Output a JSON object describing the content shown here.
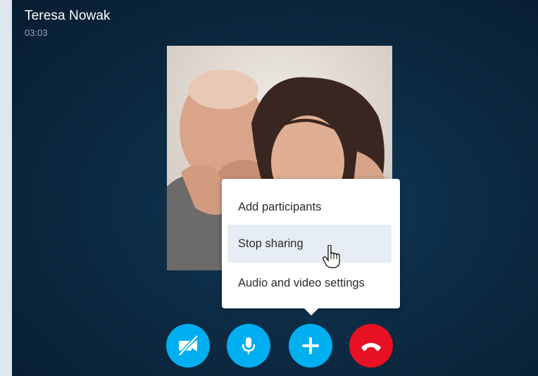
{
  "call": {
    "caller_name": "Teresa Nowak",
    "duration": "03:03"
  },
  "menu": {
    "items": [
      {
        "label": "Add participants"
      },
      {
        "label": "Stop sharing",
        "hovered": true
      },
      {
        "label": "Audio and video settings"
      }
    ]
  },
  "controls": [
    {
      "icon": "video-off-icon",
      "color": "#00aff0"
    },
    {
      "icon": "microphone-icon",
      "color": "#00aff0"
    },
    {
      "icon": "plus-icon",
      "color": "#00aff0"
    },
    {
      "icon": "hang-up-icon",
      "color": "#e81123"
    }
  ]
}
